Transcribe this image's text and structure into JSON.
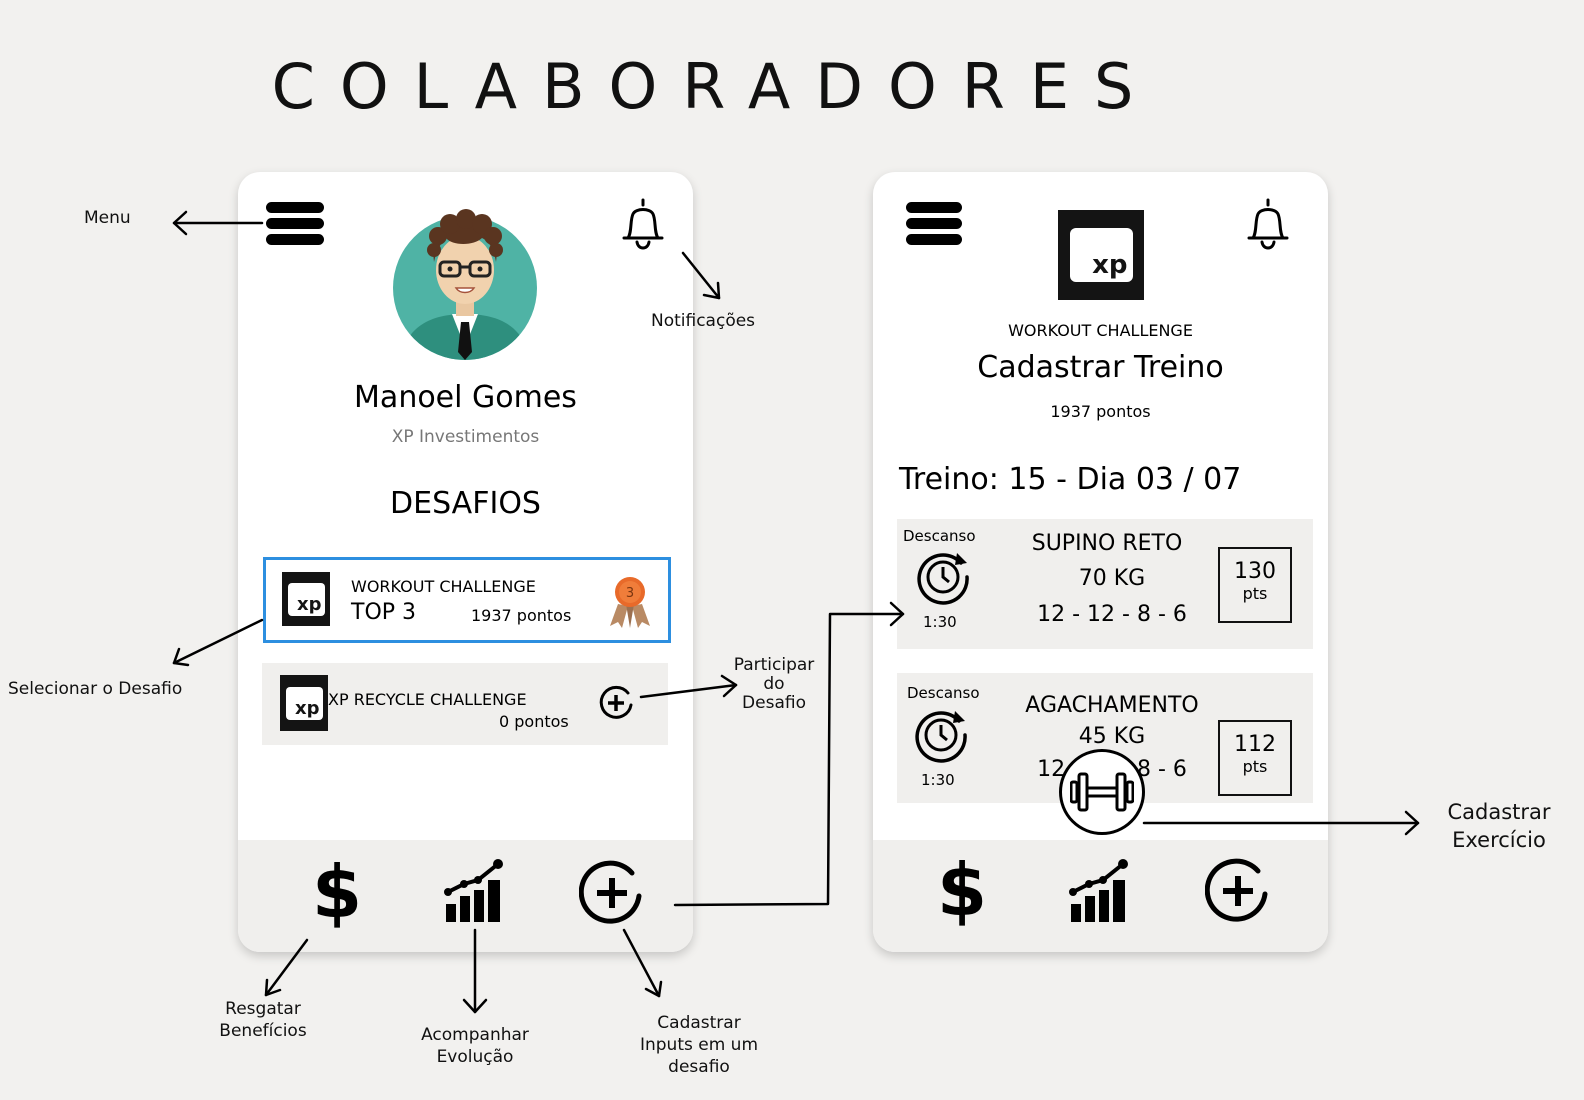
{
  "title": "COLABORADORES",
  "phone1": {
    "user_name": "Manoel Gomes",
    "company": "XP Investimentos",
    "section_title": "DESAFIOS",
    "challenges": [
      {
        "logo": "xp",
        "name": "WORKOUT CHALLENGE",
        "rank": "TOP 3",
        "points": "1937 pontos",
        "badge_icon": "medal-icon",
        "badge_number": "3",
        "selected": true
      },
      {
        "logo": "xp",
        "name": "XP  RECYCLE CHALLENGE",
        "points": "0 pontos",
        "action_icon": "plus-circle-icon",
        "selected": false
      }
    ],
    "nav": [
      {
        "icon": "dollar-icon",
        "glyph": "$"
      },
      {
        "icon": "bar-chart-growth-icon"
      },
      {
        "icon": "plus-circle-icon"
      }
    ]
  },
  "phone2": {
    "logo": "xp",
    "challenge_name": "WORKOUT CHALLENGE",
    "title": "Cadastrar Treino",
    "points": "1937 pontos",
    "session_heading": "Treino: 15 - Dia 03 / 07",
    "exercises": [
      {
        "rest_label": "Descanso",
        "rest_time": "1:30",
        "name": "SUPINO  RETO",
        "weight": "70 KG",
        "reps": "12 - 12 - 8 - 6",
        "points_value": "130",
        "points_unit": "pts"
      },
      {
        "rest_label": "Descanso",
        "rest_time": "1:30",
        "name": "AGACHAMENTO",
        "weight": "45 KG",
        "reps": "12 - 12 - 8 - 6",
        "points_value": "112",
        "points_unit": "pts"
      }
    ],
    "fab_icon": "dumbbell-icon",
    "nav": [
      {
        "icon": "dollar-icon",
        "glyph": "$"
      },
      {
        "icon": "bar-chart-growth-icon"
      },
      {
        "icon": "plus-circle-icon"
      }
    ]
  },
  "annotations": {
    "menu": "Menu",
    "notifications": "Notificações",
    "select_challenge": "Selecionar o Desafio",
    "join_challenge": [
      "Participar",
      "do",
      "Desafio"
    ],
    "redeem_benefits": [
      "Resgatar",
      "Benefícios"
    ],
    "track_progress": [
      "Acompanhar",
      "Evolução"
    ],
    "register_inputs": [
      "Cadastrar",
      "Inputs em um",
      "desafio"
    ],
    "register_exercise": [
      "Cadastrar",
      "Exercício"
    ]
  }
}
